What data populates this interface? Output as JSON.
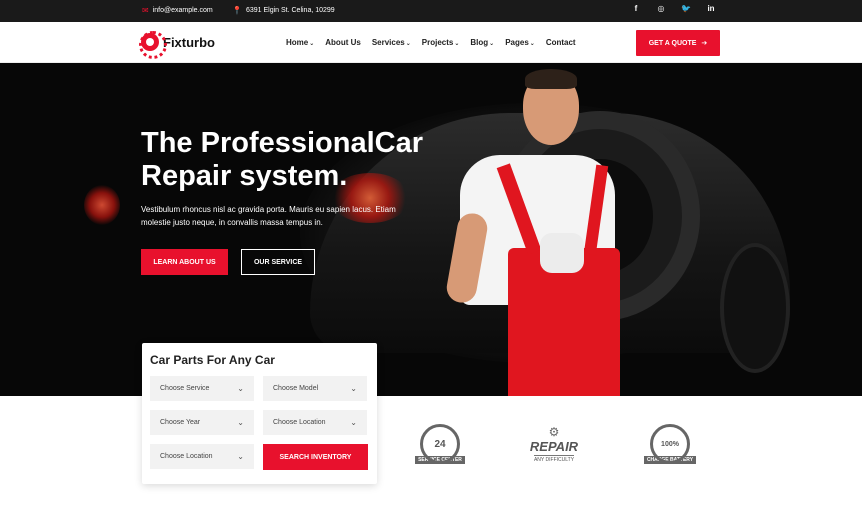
{
  "topbar": {
    "email": "info@example.com",
    "address": "6391 Elgin St. Celina, 10299",
    "socials": [
      "facebook-icon",
      "instagram-icon",
      "twitter-icon",
      "linkedin-icon"
    ]
  },
  "header": {
    "brand": "Fixturbo",
    "nav": [
      {
        "label": "Home",
        "caret": true
      },
      {
        "label": "About Us",
        "caret": false
      },
      {
        "label": "Services",
        "caret": true
      },
      {
        "label": "Projects",
        "caret": true
      },
      {
        "label": "Blog",
        "caret": true
      },
      {
        "label": "Pages",
        "caret": true
      },
      {
        "label": "Contact",
        "caret": false
      }
    ],
    "quote_button": "GET A QUOTE"
  },
  "hero": {
    "title_line1": "The ProfessionalCar",
    "title_line2": "Repair system.",
    "description": "Vestibulum rhoncus nisl ac gravida porta. Mauris eu sapien lacus. Etiam molestie justo neque, in convallis massa tempus in.",
    "primary_button": "LEARN ABOUT US",
    "secondary_button": "OUR SERVICE"
  },
  "parts_search": {
    "title": "Car Parts For Any Car",
    "selects": [
      "Choose Service",
      "Choose Model",
      "Choose Year",
      "Choose Location",
      "Choose Location"
    ],
    "search_button": "SEARCH INVENTORY"
  },
  "badges": {
    "b1_top": "24",
    "b1_label": "SERVICE CENTER",
    "b2_main": "REPAIR",
    "b2_sub": "ANY DIFFICULTY",
    "b3_top": "100%",
    "b3_label": "CHARGE BATTERY"
  },
  "colors": {
    "accent": "#e8112d",
    "topbar_bg": "#1a1a1a",
    "hero_bg": "#070707"
  }
}
